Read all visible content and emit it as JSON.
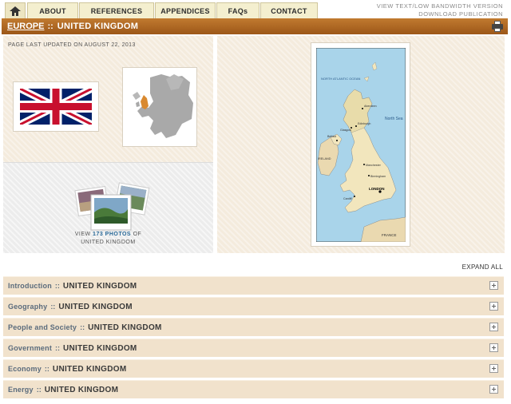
{
  "nav": {
    "tabs": [
      {
        "label": "ABOUT"
      },
      {
        "label": "REFERENCES"
      },
      {
        "label": "APPENDICES"
      },
      {
        "label": "FAQs"
      },
      {
        "label": "CONTACT"
      }
    ],
    "right_links": {
      "text_version": "VIEW TEXT/LOW BANDWIDTH VERSION",
      "download": "DOWNLOAD PUBLICATION"
    }
  },
  "title_bar": {
    "region": "EUROPE",
    "separator": "::",
    "country": "UNITED KINGDOM"
  },
  "left_panel": {
    "updated": "PAGE LAST UPDATED ON AUGUST 22, 2013",
    "photos": {
      "prefix": "VIEW",
      "count": "173 PHOTOS",
      "suffix": "OF",
      "country": "UNITED KINGDOM"
    }
  },
  "map_labels": {
    "north_atlantic": "NORTH ATLANTIC OCEAN",
    "north_sea": "North Sea",
    "london": "LONDON",
    "ireland": "IRELAND",
    "france": "FRANCE",
    "edinburgh": "Edinburgh",
    "glasgow": "Glasgow",
    "birmingham": "Birmingham",
    "manchester": "Manchester",
    "cardiff": "Cardiff",
    "belfast": "Belfast",
    "aberdeen": "Aberdeen"
  },
  "expand_all": "EXPAND ALL",
  "accordion": [
    {
      "section": "Introduction",
      "country": "UNITED KINGDOM"
    },
    {
      "section": "Geography",
      "country": "UNITED KINGDOM"
    },
    {
      "section": "People and Society",
      "country": "UNITED KINGDOM"
    },
    {
      "section": "Government",
      "country": "UNITED KINGDOM"
    },
    {
      "section": "Economy",
      "country": "UNITED KINGDOM"
    },
    {
      "section": "Energy",
      "country": "UNITED KINGDOM"
    }
  ],
  "colors": {
    "title_bar": "#a9621f",
    "panel_bg": "#f4ebdd",
    "accordion_bg": "#f1e2cc",
    "photo_count": "#2a6a99"
  }
}
